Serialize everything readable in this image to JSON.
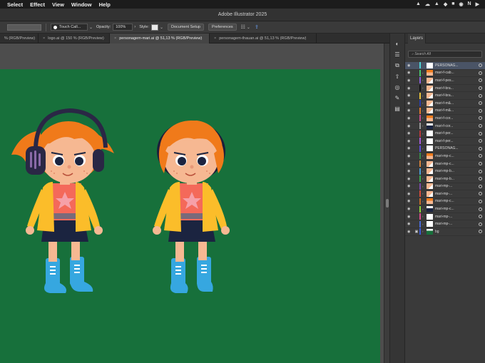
{
  "menubar": {
    "items": [
      "Select",
      "Effect",
      "View",
      "Window",
      "Help"
    ],
    "status_icons": [
      "▲",
      "☁",
      "▲",
      "◆",
      "■",
      "◉",
      "N",
      "▶"
    ]
  },
  "window": {
    "title": "Adobe Illustrator 2025"
  },
  "controlbar": {
    "brush_name": "Touch Call...",
    "opacity_label": "Opacity:",
    "opacity_value": "100%",
    "style_label": "Style:",
    "document_setup": "Document Setup",
    "preferences": "Preferences"
  },
  "tabs": [
    {
      "label": "% (RGB/Preview)",
      "closable": false,
      "active": false
    },
    {
      "label": "logo.ai @ 150 % (RGB/Preview)",
      "closable": true,
      "active": false
    },
    {
      "label": "personagem-mari.ai @ 51,13 % (RGB/Preview)",
      "closable": true,
      "active": true
    },
    {
      "label": "personagem-thauan.ai @ 51,13 % (RGB/Preview)",
      "closable": true,
      "active": false
    }
  ],
  "colors": {
    "artboard": "#17703b",
    "hair": "#f07a1a",
    "skin": "#f6b892",
    "jacket": "#fbbd2a",
    "shirt": "#f4695a",
    "skirt": "#1b2440",
    "boots": "#36a7e0",
    "headphones": "#2a2745"
  },
  "layers_panel": {
    "tab_label": "Layers",
    "search_placeholder": "Search All",
    "layers": [
      {
        "name": "PERSONAG...",
        "color": "#4fd3d3",
        "selected": true,
        "locked": false,
        "thumb": "blank"
      },
      {
        "name": "mari-f-cab...",
        "color": "#49c46b",
        "selected": false,
        "locked": false,
        "thumb": "char"
      },
      {
        "name": "mari-f-pes...",
        "color": "#8a5cd6",
        "selected": false,
        "locked": false,
        "thumb": "skin"
      },
      {
        "name": "mari-f-bra...",
        "color": "#111111",
        "selected": false,
        "locked": false,
        "thumb": "skin"
      },
      {
        "name": "mari-f-bra...",
        "color": "#e8c23a",
        "selected": false,
        "locked": false,
        "thumb": "skin"
      },
      {
        "name": "mari-f-m&...",
        "color": "#2a3ea8",
        "selected": false,
        "locked": false,
        "thumb": "skin"
      },
      {
        "name": "mari-f-m&...",
        "color": "#e07a2a",
        "selected": false,
        "locked": false,
        "thumb": "skin"
      },
      {
        "name": "mari-f-cor...",
        "color": "#c44a8a",
        "selected": false,
        "locked": false,
        "thumb": "char"
      },
      {
        "name": "mari-f-cor...",
        "color": "#9a9a9a",
        "selected": false,
        "locked": false,
        "thumb": "dark"
      },
      {
        "name": "mari-f-per...",
        "color": "#b83a3a",
        "selected": false,
        "locked": false,
        "thumb": "blank"
      },
      {
        "name": "mari-f-per...",
        "color": "#a85ad6",
        "selected": false,
        "locked": false,
        "thumb": "blank"
      },
      {
        "name": "PERSONAG...",
        "color": "#5a4ad6",
        "selected": false,
        "locked": false,
        "thumb": "blank"
      },
      {
        "name": "mari-mp-c...",
        "color": "#3a8a4a",
        "selected": false,
        "locked": false,
        "thumb": "char"
      },
      {
        "name": "mari-mp-c...",
        "color": "#d6823a",
        "selected": false,
        "locked": false,
        "thumb": "skin"
      },
      {
        "name": "mari-mp-b...",
        "color": "#4a9ad6",
        "selected": false,
        "locked": false,
        "thumb": "skin"
      },
      {
        "name": "mari-mp-b...",
        "color": "#3aa84a",
        "selected": false,
        "locked": false,
        "thumb": "skin"
      },
      {
        "name": "mari-mp-...",
        "color": "#7a4aa8",
        "selected": false,
        "locked": false,
        "thumb": "skin"
      },
      {
        "name": "mari-mp-...",
        "color": "#d64a3a",
        "selected": false,
        "locked": false,
        "thumb": "skin"
      },
      {
        "name": "mari-mp-c...",
        "color": "#c46a2a",
        "selected": false,
        "locked": false,
        "thumb": "char"
      },
      {
        "name": "mari-mp-c...",
        "color": "#8ad63a",
        "selected": false,
        "locked": false,
        "thumb": "dark"
      },
      {
        "name": "mari-mp-...",
        "color": "#d64a8a",
        "selected": false,
        "locked": false,
        "thumb": "blank"
      },
      {
        "name": "mari-mp-...",
        "color": "#4a6ad6",
        "selected": false,
        "locked": false,
        "thumb": "blank"
      },
      {
        "name": "bg",
        "color": "#3a5ad6",
        "selected": false,
        "locked": true,
        "thumb": "green"
      }
    ]
  }
}
